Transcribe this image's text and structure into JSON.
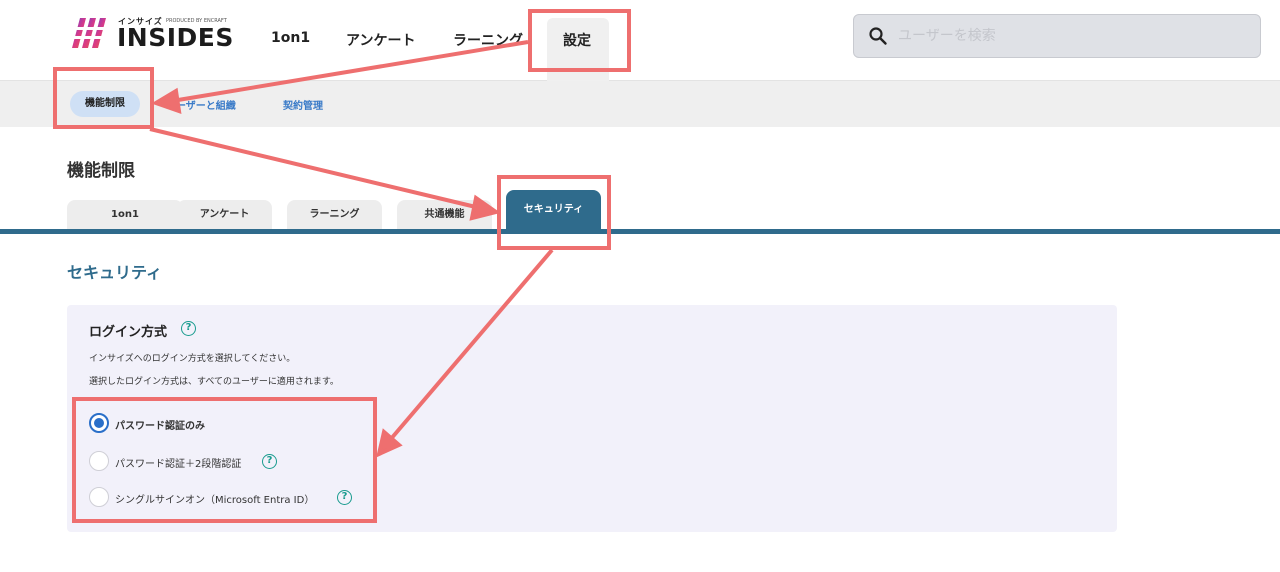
{
  "header": {
    "logo": {
      "kana": "インサイズ",
      "produced_by": "PRODUCED BY",
      "brand": "ENCRAFT",
      "wordmark": "INSIDES"
    },
    "nav": [
      {
        "label": "1on1"
      },
      {
        "label": "アンケート"
      },
      {
        "label": "ラーニング"
      },
      {
        "label": "設定",
        "active": true
      }
    ],
    "search": {
      "placeholder": "ユーザーを検索",
      "icon": "search-icon"
    }
  },
  "subnav": [
    {
      "label": "機能制限",
      "active": true
    },
    {
      "label": "ユーザーと組織"
    },
    {
      "label": "契約管理"
    }
  ],
  "page_title": "機能制限",
  "tabs": [
    {
      "label": "1on1"
    },
    {
      "label": "アンケート"
    },
    {
      "label": "ラーニング"
    },
    {
      "label": "共通機能"
    },
    {
      "label": "セキュリティ",
      "active": true
    }
  ],
  "section_title": "セキュリティ",
  "login_method": {
    "heading": "ログイン方式",
    "help_glyph": "?",
    "desc1": "インサイズへのログイン方式を選択してください。",
    "desc2": "選択したログイン方式は、すべてのユーザーに適用されます。",
    "options": [
      {
        "label": "パスワード認証のみ",
        "selected": true
      },
      {
        "label": "パスワード認証＋2段階認証",
        "selected": false
      },
      {
        "label": "シングルサインオン（Microsoft Entra ID）",
        "selected": false
      }
    ]
  },
  "colors": {
    "accent": "#2f6b8c",
    "annotation": "#ee6f6f",
    "radio_selected": "#2a6fc9",
    "help": "#1a9c8f"
  }
}
